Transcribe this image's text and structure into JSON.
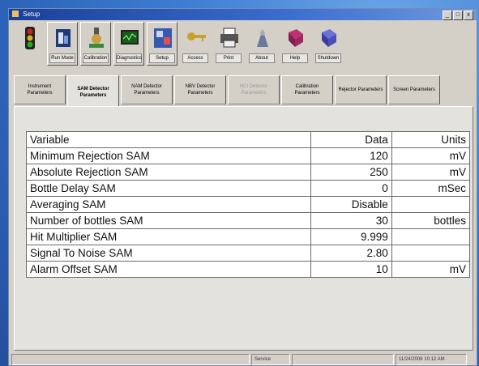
{
  "window": {
    "title": "Setup",
    "controls": [
      "_",
      "□",
      "x"
    ]
  },
  "toolbar": [
    {
      "icon": "traffic-light-icon",
      "label": ""
    },
    {
      "icon": "gauge-icon",
      "label": "Run Mode"
    },
    {
      "icon": "calibration-icon",
      "label": "Calibration"
    },
    {
      "icon": "monitor-icon",
      "label": "Diagnostics"
    },
    {
      "icon": "setup-icon",
      "label": "Setup"
    },
    {
      "icon": "key-icon",
      "label": "Access"
    },
    {
      "icon": "printer-icon",
      "label": "Print"
    },
    {
      "icon": "about-icon",
      "label": "About"
    },
    {
      "icon": "help-book-icon",
      "label": "Help"
    },
    {
      "icon": "shutdown-icon",
      "label": "Shutdown"
    }
  ],
  "tabs": [
    {
      "label": "Instrument\nParameters",
      "state": "normal"
    },
    {
      "label": "SAM Detector\nParameters",
      "state": "active"
    },
    {
      "label": "NAM Detector\nParameters",
      "state": "normal"
    },
    {
      "label": "NBV Detector\nParameters",
      "state": "normal"
    },
    {
      "label": "HCI Detector\nParameters",
      "state": "disabled"
    },
    {
      "label": "Calibration\nParameters",
      "state": "normal"
    },
    {
      "label": "Rejector Parameters",
      "state": "normal"
    },
    {
      "label": "Screen Parameters",
      "state": "normal"
    }
  ],
  "table": {
    "headers": {
      "variable": "Variable",
      "data": "Data",
      "units": "Units"
    },
    "rows": [
      {
        "variable": "Minimum Rejection SAM",
        "data": "120",
        "units": "mV"
      },
      {
        "variable": "Absolute Rejection SAM",
        "data": "250",
        "units": "mV"
      },
      {
        "variable": "Bottle Delay SAM",
        "data": "0",
        "units": "mSec"
      },
      {
        "variable": "Averaging SAM",
        "data": "Disable",
        "units": ""
      },
      {
        "variable": "Number of bottles SAM",
        "data": "30",
        "units": "bottles"
      },
      {
        "variable": "Hit Multiplier SAM",
        "data": "9.999",
        "units": ""
      },
      {
        "variable": "Signal To Noise SAM",
        "data": "2.80",
        "units": ""
      },
      {
        "variable": "Alarm Offset SAM",
        "data": "10",
        "units": "mV"
      }
    ]
  },
  "status": {
    "mode": "Service",
    "datetime": "11/24/2006  10:12 AM"
  }
}
